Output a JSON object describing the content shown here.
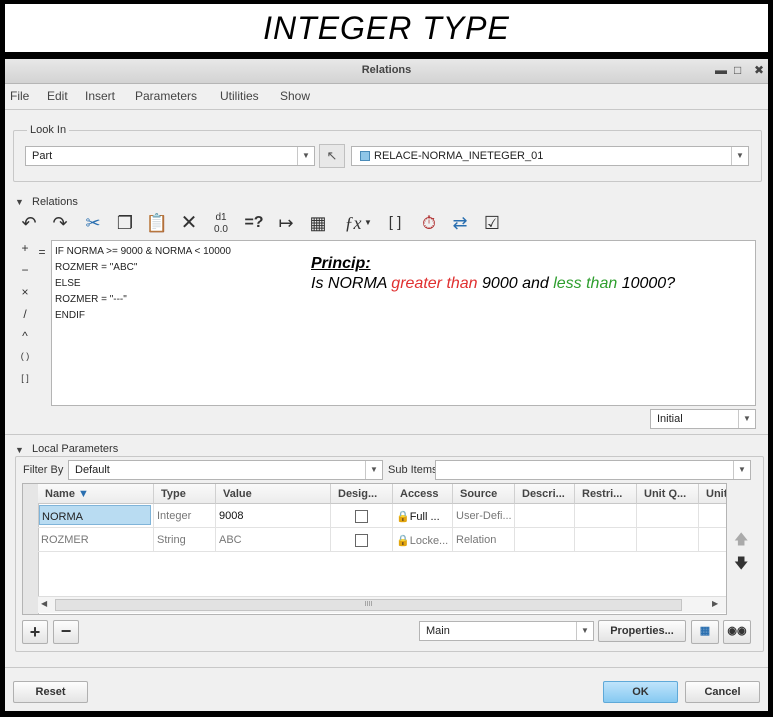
{
  "banner": {
    "title": "INTEGER TYPE"
  },
  "window": {
    "title": "Relations"
  },
  "menu": [
    "File",
    "Edit",
    "Insert",
    "Parameters",
    "Utilities",
    "Show"
  ],
  "look_in": {
    "label": "Look In",
    "type_value": "Part",
    "model_value": "RELACE-NORMA_INETEGER_01"
  },
  "relations": {
    "section_label": "Relations",
    "code_lines": [
      "IF NORMA >= 9000 & NORMA < 10000",
      "ROZMER = \"ABC\"",
      "ELSE",
      "ROZMER = \"---\"",
      "ENDIF"
    ],
    "operators": [
      "+",
      "=",
      "−",
      "×",
      "/",
      "^",
      "( )",
      "[ ]"
    ],
    "status_value": "Initial"
  },
  "annotation": {
    "heading": "Princip:",
    "pre": "Is NORMA ",
    "greater": "greater than",
    "mid": " 9000 and ",
    "less": "less than",
    "post": " 10000?",
    "greater_color": "#e03030",
    "less_color": "#2e9e2e"
  },
  "local_parameters": {
    "section_label": "Local Parameters",
    "filter_label": "Filter By",
    "filter_value": "Default",
    "subitems_label": "Sub Items",
    "columns": [
      "Name",
      "Type",
      "Value",
      "Desig...",
      "Access",
      "Source",
      "Descri...",
      "Restri...",
      "Unit Q...",
      "Unit"
    ],
    "rows": [
      {
        "name": "NORMA",
        "type": "Integer",
        "value": "9008",
        "access": "Full",
        "source": "User-Defi..."
      },
      {
        "name": "ROZMER",
        "type": "String",
        "value": "ABC",
        "access": "Locke...",
        "source": "Relation"
      }
    ],
    "scroll_mark": "IIII",
    "bottom_combo": "Main",
    "properties_label": "Properties..."
  },
  "footer": {
    "reset": "Reset",
    "ok": "OK",
    "cancel": "Cancel"
  }
}
